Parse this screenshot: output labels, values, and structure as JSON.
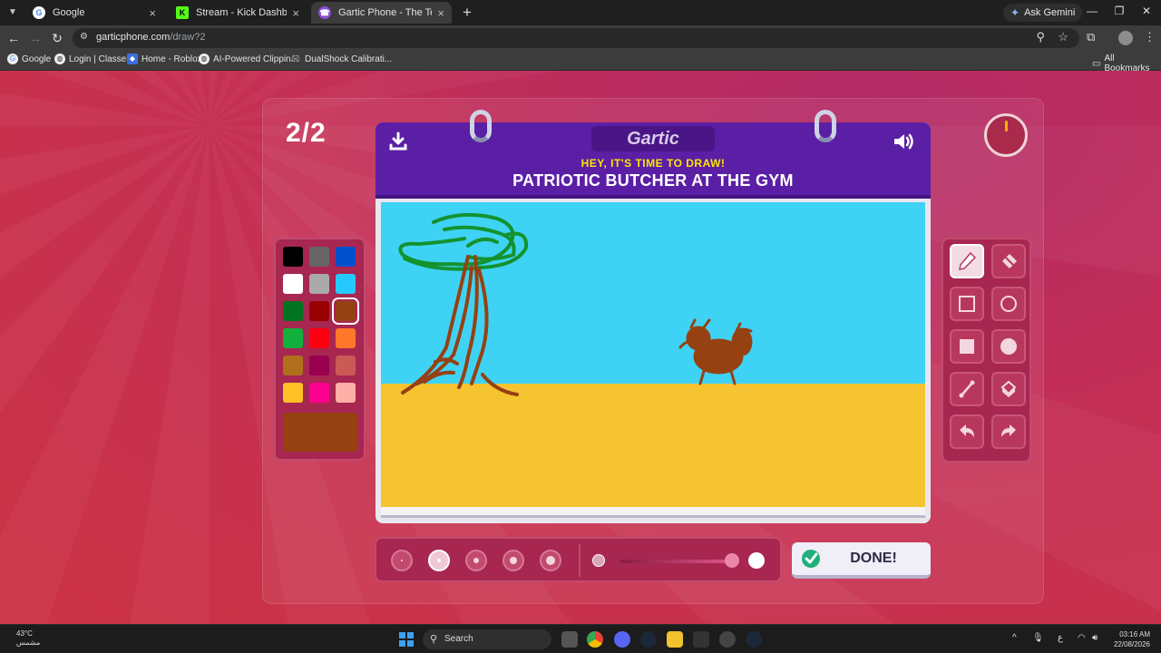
{
  "browser": {
    "tabs": [
      {
        "title": "Google",
        "favicon": "google-icon",
        "active": false
      },
      {
        "title": "Stream - Kick Dashboard",
        "favicon": "kick-icon",
        "active": false
      },
      {
        "title": "Gartic Phone - The Telephone G",
        "favicon": "gartic-icon",
        "active": true
      }
    ],
    "gemini_label": "Ask Gemini",
    "url_host": "garticphone.com",
    "url_path": "/draw?2",
    "bookmarks": [
      {
        "label": "Google"
      },
      {
        "label": "Login | Classera"
      },
      {
        "label": "Home - Roblox"
      },
      {
        "label": "AI-Powered Clippin..."
      },
      {
        "label": "DualShock Calibrati..."
      }
    ],
    "all_bookmarks_label": "All Bookmarks"
  },
  "game": {
    "round": "2/2",
    "logo": "Gartic",
    "subtitle": "HEY, IT'S TIME TO DRAW!",
    "prompt": "PATRIOTIC BUTCHER AT THE GYM",
    "done_label": "DONE!",
    "canvas": {
      "sky": "#3ed3f5",
      "ground": "#f7c431"
    },
    "palette": [
      "#000000",
      "#666666",
      "#0050cd",
      "#ffffff",
      "#aaaaaa",
      "#26c9ff",
      "#017420",
      "#990000",
      "#964112",
      "#11b03c",
      "#ff0013",
      "#ff7829",
      "#b0701c",
      "#99004e",
      "#cb5a57",
      "#ffc126",
      "#ff008f",
      "#feafa8"
    ],
    "selected_color_index": 8,
    "current_color": "#964112",
    "tools": [
      {
        "name": "pencil-icon",
        "selected": true
      },
      {
        "name": "eraser-icon",
        "selected": false
      },
      {
        "name": "rectangle-icon",
        "selected": false
      },
      {
        "name": "ellipse-icon",
        "selected": false
      },
      {
        "name": "filled-rectangle-icon",
        "selected": false
      },
      {
        "name": "filled-ellipse-icon",
        "selected": false
      },
      {
        "name": "line-icon",
        "selected": false
      },
      {
        "name": "fill-bucket-icon",
        "selected": false
      },
      {
        "name": "undo-icon",
        "selected": false
      },
      {
        "name": "redo-icon",
        "selected": false
      }
    ],
    "brush_sizes": 5,
    "selected_brush_size_index": 1,
    "opacity_percent": 85
  },
  "taskbar": {
    "weather_temp": "43°C",
    "weather_desc": "مشمس",
    "search_label": "Search",
    "tray_lang": "ع",
    "time": "03:16 AM",
    "date": "22/08/2026"
  }
}
